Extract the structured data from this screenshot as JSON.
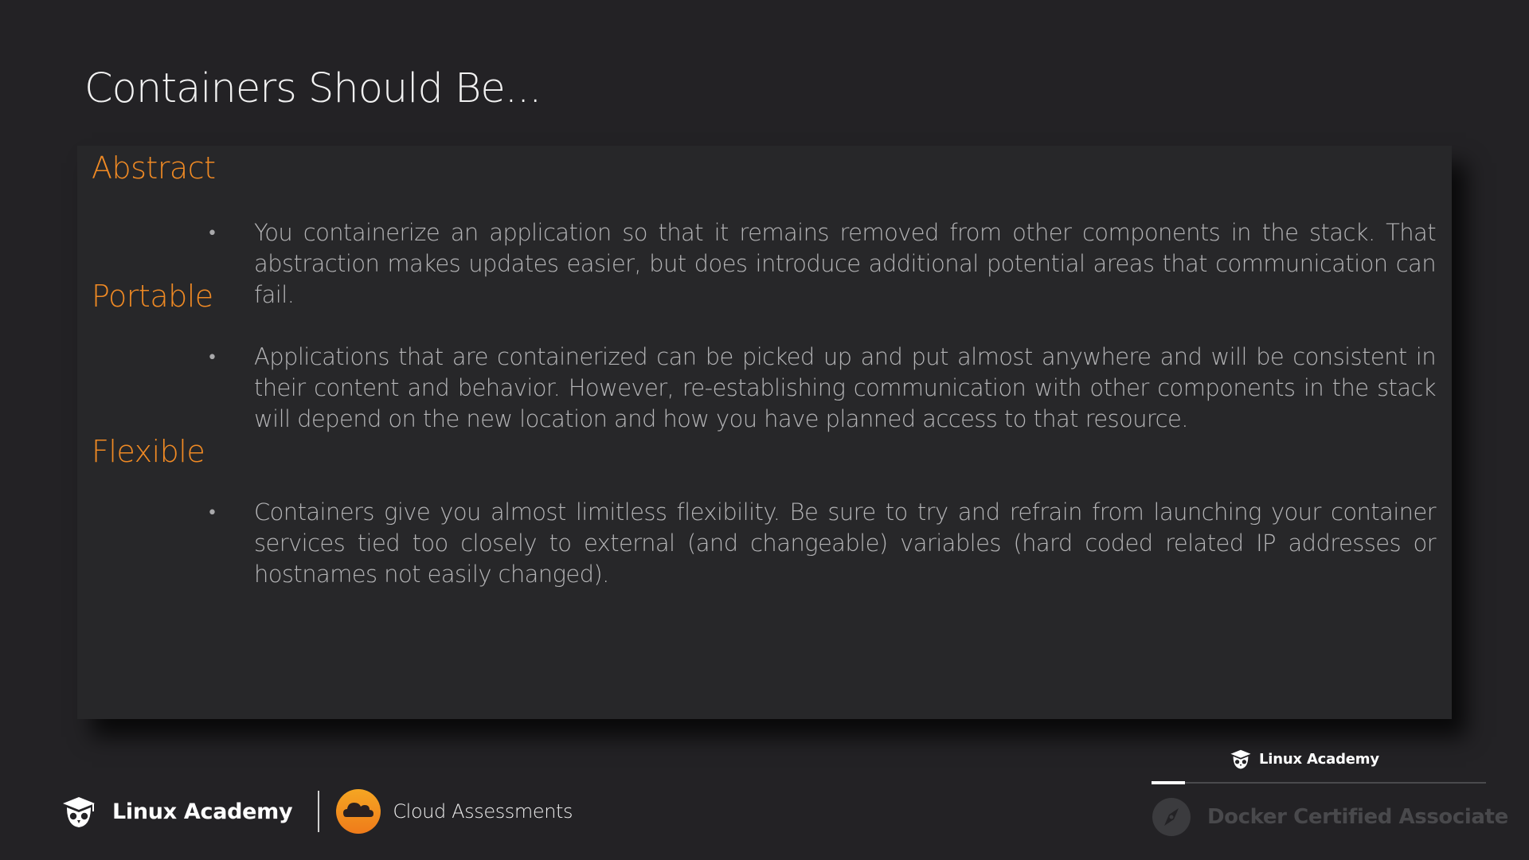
{
  "slide": {
    "title": "Containers Should Be..."
  },
  "sections": [
    {
      "heading": "Abstract",
      "bullet": "You containerize an application so that it remains removed from other components in the stack. That abstraction makes updates easier, but does introduce additional potential areas that communication can fail."
    },
    {
      "heading": "Portable",
      "bullet": "Applications that are containerized can be picked up and put almost anywhere and will be consistent in their content and behavior. However, re-establishing communication with other components in the stack will depend on the new location and how you have planned access to that resource."
    },
    {
      "heading": "Flexible",
      "bullet": "Containers give you almost limitless flexibility. Be sure to try and refrain from launching your container services tied too closely to external (and changeable) variables (hard coded related IP addresses or hostnames not easily changed)."
    }
  ],
  "bullet_symbol": "•",
  "footer": {
    "brand_name": "Linux Academy",
    "brand_icon": "owl-mortarboard-icon",
    "partner_name": "Cloud Assessments",
    "partner_icon": "cloud-icon"
  },
  "course_badge": {
    "label": "Linux Academy",
    "course_name": "Docker Certified Associate",
    "course_icon": "compass-icon",
    "progress_fraction": 0.1
  },
  "colors": {
    "background": "#232225",
    "panel": "#272729",
    "accent": "#f08a24",
    "body_text": "#b4b4b6",
    "course_name_dim": "#49494c"
  }
}
